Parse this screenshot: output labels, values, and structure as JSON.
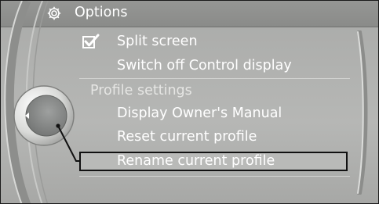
{
  "window": {
    "title": "Options"
  },
  "menu": {
    "items": [
      {
        "label": "Split screen",
        "kind": "checkbox",
        "checked": true
      },
      {
        "label": "Switch off Control display",
        "kind": "action"
      },
      {
        "label": "Profile settings",
        "kind": "section-header"
      },
      {
        "label": "Display Owner's Manual",
        "kind": "action"
      },
      {
        "label": "Reset current profile",
        "kind": "action"
      },
      {
        "label": "Rename current profile",
        "kind": "action",
        "selected": true
      }
    ]
  },
  "icons": {
    "title": "gear-icon",
    "checkbox": "checkmark-icon",
    "controller": "controller-knob-icon",
    "controller_arrow": "left-arrow-icon"
  },
  "colors": {
    "background": "#b1b2b0",
    "titlebar": "#8e8f8d",
    "text": "#ffffff",
    "selection_border": "#111111"
  }
}
